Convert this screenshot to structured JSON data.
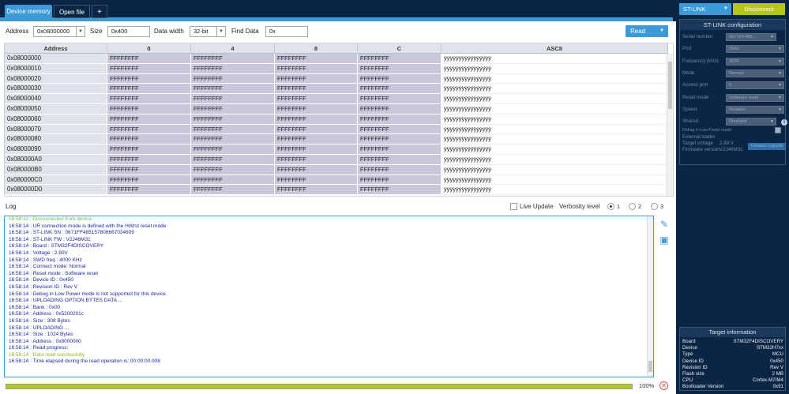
{
  "tabs": {
    "device_memory": "Device memory",
    "open_file": "Open file",
    "add": "+"
  },
  "toolbar": {
    "address_label": "Address",
    "address_value": "0x08000000",
    "size_label": "Size",
    "size_value": "0x400",
    "data_width_label": "Data width",
    "data_width_value": "32-bit",
    "find_label": "Find Data",
    "find_value": "0x",
    "read_label": "Read"
  },
  "table": {
    "headers": [
      "Address",
      "0",
      "4",
      "8",
      "C",
      "ASCII"
    ],
    "rows": [
      {
        "addr": "0x08000000",
        "v": [
          "FFFFFFFF",
          "FFFFFFFF",
          "FFFFFFFF",
          "FFFFFFFF"
        ],
        "ascii": "ÿÿÿÿÿÿÿÿÿÿÿÿÿÿÿÿ"
      },
      {
        "addr": "0x08000010",
        "v": [
          "FFFFFFFF",
          "FFFFFFFF",
          "FFFFFFFF",
          "FFFFFFFF"
        ],
        "ascii": "ÿÿÿÿÿÿÿÿÿÿÿÿÿÿÿÿ"
      },
      {
        "addr": "0x08000020",
        "v": [
          "FFFFFFFF",
          "FFFFFFFF",
          "FFFFFFFF",
          "FFFFFFFF"
        ],
        "ascii": "ÿÿÿÿÿÿÿÿÿÿÿÿÿÿÿÿ"
      },
      {
        "addr": "0x08000030",
        "v": [
          "FFFFFFFF",
          "FFFFFFFF",
          "FFFFFFFF",
          "FFFFFFFF"
        ],
        "ascii": "ÿÿÿÿÿÿÿÿÿÿÿÿÿÿÿÿ"
      },
      {
        "addr": "0x08000040",
        "v": [
          "FFFFFFFF",
          "FFFFFFFF",
          "FFFFFFFF",
          "FFFFFFFF"
        ],
        "ascii": "ÿÿÿÿÿÿÿÿÿÿÿÿÿÿÿÿ"
      },
      {
        "addr": "0x08000050",
        "v": [
          "FFFFFFFF",
          "FFFFFFFF",
          "FFFFFFFF",
          "FFFFFFFF"
        ],
        "ascii": "ÿÿÿÿÿÿÿÿÿÿÿÿÿÿÿÿ"
      },
      {
        "addr": "0x08000060",
        "v": [
          "FFFFFFFF",
          "FFFFFFFF",
          "FFFFFFFF",
          "FFFFFFFF"
        ],
        "ascii": "ÿÿÿÿÿÿÿÿÿÿÿÿÿÿÿÿ"
      },
      {
        "addr": "0x08000070",
        "v": [
          "FFFFFFFF",
          "FFFFFFFF",
          "FFFFFFFF",
          "FFFFFFFF"
        ],
        "ascii": "ÿÿÿÿÿÿÿÿÿÿÿÿÿÿÿÿ"
      },
      {
        "addr": "0x08000080",
        "v": [
          "FFFFFFFF",
          "FFFFFFFF",
          "FFFFFFFF",
          "FFFFFFFF"
        ],
        "ascii": "ÿÿÿÿÿÿÿÿÿÿÿÿÿÿÿÿ"
      },
      {
        "addr": "0x08000090",
        "v": [
          "FFFFFFFF",
          "FFFFFFFF",
          "FFFFFFFF",
          "FFFFFFFF"
        ],
        "ascii": "ÿÿÿÿÿÿÿÿÿÿÿÿÿÿÿÿ"
      },
      {
        "addr": "0x080000A0",
        "v": [
          "FFFFFFFF",
          "FFFFFFFF",
          "FFFFFFFF",
          "FFFFFFFF"
        ],
        "ascii": "ÿÿÿÿÿÿÿÿÿÿÿÿÿÿÿÿ"
      },
      {
        "addr": "0x080000B0",
        "v": [
          "FFFFFFFF",
          "FFFFFFFF",
          "FFFFFFFF",
          "FFFFFFFF"
        ],
        "ascii": "ÿÿÿÿÿÿÿÿÿÿÿÿÿÿÿÿ"
      },
      {
        "addr": "0x080000C0",
        "v": [
          "FFFFFFFF",
          "FFFFFFFF",
          "FFFFFFFF",
          "FFFFFFFF"
        ],
        "ascii": "ÿÿÿÿÿÿÿÿÿÿÿÿÿÿÿÿ"
      },
      {
        "addr": "0x080000D0",
        "v": [
          "FFFFFFFF",
          "FFFFFFFF",
          "FFFFFFFF",
          "FFFFFFFF"
        ],
        "ascii": "ÿÿÿÿÿÿÿÿÿÿÿÿÿÿÿÿ"
      }
    ]
  },
  "log": {
    "title": "Log",
    "live_update": "Live Update",
    "verbosity_label": "Verbosity level",
    "levels": [
      "1",
      "2",
      "3"
    ],
    "lines": [
      {
        "t": "16:58:11 : Disconnected from device.",
        "g": true
      },
      {
        "t": "16:58:14 : UR connection mode is defined with the HWrst reset mode",
        "g": false
      },
      {
        "t": "16:58:14 : ST-LINK SN  : 0671FF485157808667034609",
        "g": false
      },
      {
        "t": "16:58:14 : ST-LINK FW  : V2J46M31",
        "g": false
      },
      {
        "t": "16:58:14 : Board       : STM32F4DISCOVERY",
        "g": false
      },
      {
        "t": "16:58:14 : Voltage     : 2.90V",
        "g": false
      },
      {
        "t": "16:58:14 : SWD freq    : 4000 KHz",
        "g": false
      },
      {
        "t": "16:58:14 : Connect mode: Normal",
        "g": false
      },
      {
        "t": "16:58:14 : Reset mode  : Software reset",
        "g": false
      },
      {
        "t": "16:58:14 : Device ID   : 0x450",
        "g": false
      },
      {
        "t": "16:58:14 : Revision ID : Rev V",
        "g": false
      },
      {
        "t": "16:58:14 : Debug in Low Power mode is not supported for this device.",
        "g": false
      },
      {
        "t": "16:58:14 : UPLOADING OPTION BYTES DATA ...",
        "g": false
      },
      {
        "t": "16:58:14 :   Bank          : 0x00",
        "g": false
      },
      {
        "t": "16:58:14 :   Address       : 0x5200201c",
        "g": false
      },
      {
        "t": "16:58:14 :   Size          : 308 Bytes",
        "g": false
      },
      {
        "t": "16:58:14 : UPLOADING ...",
        "g": false
      },
      {
        "t": "16:58:14 :   Size          : 1024 Bytes",
        "g": false
      },
      {
        "t": "16:58:14 :   Address       : 0x8000000",
        "g": false
      },
      {
        "t": "16:58:14 : Read progress:",
        "g": false
      },
      {
        "t": "16:58:14 : Data read successfully",
        "g": true
      },
      {
        "t": "16:58:14 : Time elapsed during the read operation is: 00:00:00.008",
        "g": false
      }
    ],
    "progress": 1.0,
    "progress_text": "100%"
  },
  "right": {
    "stlink_label": "ST-LINK",
    "disconnect_label": "Disconnect",
    "config_title": "ST-LINK configuration",
    "config": [
      {
        "label": "Serial number",
        "value": "0671FF485..."
      },
      {
        "label": "Port",
        "value": "SWD"
      },
      {
        "label": "Frequency (kHz)",
        "value": "4000"
      },
      {
        "label": "Mode",
        "value": "Normal"
      },
      {
        "label": "Access port",
        "value": "0"
      },
      {
        "label": "Reset mode",
        "value": "Software reset"
      },
      {
        "label": "Speed",
        "value": "Reliable"
      },
      {
        "label": "Shared",
        "value": "Disabled"
      }
    ],
    "debug_lp": "Debug in Low Power mode",
    "ext_loader": "External loader",
    "target_voltage_label": "Target voltage",
    "target_voltage": "2.89 V",
    "fw_label": "Firmware version",
    "fw_value": "V2J46M31",
    "fw_upgrade": "Firmware upgrade",
    "target_title": "Target information",
    "target": [
      {
        "k": "Board",
        "v": "STM32F4DISCOVERY"
      },
      {
        "k": "Device",
        "v": "STM32H7xx"
      },
      {
        "k": "Type",
        "v": "MCU"
      },
      {
        "k": "Device ID",
        "v": "0x450"
      },
      {
        "k": "Revision ID",
        "v": "Rev V"
      },
      {
        "k": "Flash size",
        "v": "2 MB"
      },
      {
        "k": "CPU",
        "v": "Cortex-M7/M4"
      },
      {
        "k": "Bootloader Version",
        "v": "0x91"
      }
    ]
  },
  "colors": {
    "accent": "#3c9ad8",
    "dark": "#0b2644",
    "green": "#b5c81a",
    "cell": "#c9c7dc"
  }
}
